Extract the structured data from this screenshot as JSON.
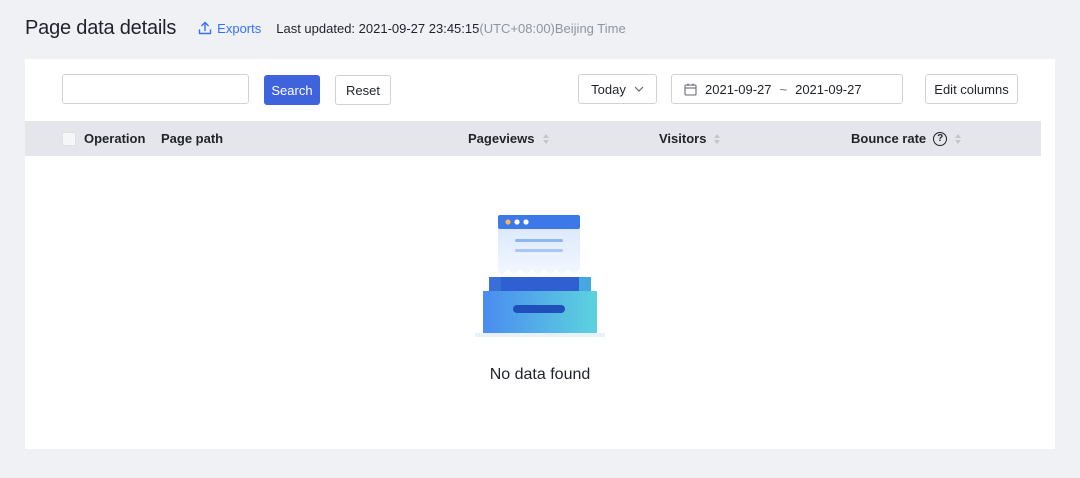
{
  "header": {
    "title": "Page data details",
    "export_label": "Exports",
    "updated_prefix": "Last updated: 2021-09-27 23:45:15",
    "updated_tz": "(UTC+08:00)Beijing Time"
  },
  "toolbar": {
    "search_value": "",
    "search_label": "Search",
    "reset_label": "Reset",
    "period_label": "Today",
    "date_start": "2021-09-27",
    "date_separator": "~",
    "date_end": "2021-09-27",
    "edit_columns_label": "Edit columns"
  },
  "table": {
    "columns": {
      "operation": "Operation",
      "page_path": "Page path",
      "pageviews": "Pageviews",
      "visitors": "Visitors",
      "bounce_rate": "Bounce rate"
    },
    "rows": [],
    "empty_text": "No data found"
  },
  "colors": {
    "accent": "#3370ff",
    "primary_button": "#3e63dd",
    "table_header_bg": "#e5e6eb",
    "page_bg": "#f0f1f5"
  }
}
